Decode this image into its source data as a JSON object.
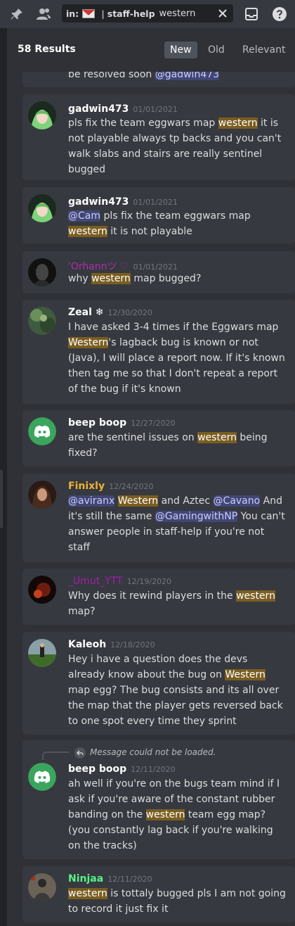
{
  "toolbar": {
    "search_prefix": "in:",
    "channel": "staff-help",
    "separator": "|",
    "query": "western"
  },
  "results": {
    "count": "58 Results",
    "sort_tabs": [
      "New",
      "Old",
      "Relevant"
    ]
  },
  "colors": {
    "highlight": "#7a5d21",
    "mention": "#414675",
    "discord_blurple": "#5865f2",
    "green_bot": "#3ba55d"
  },
  "messages": [
    {
      "text_parts": [
        {
          "t": "be resolved soon "
        },
        {
          "t": "@gadwin473",
          "mention": true
        }
      ]
    },
    {
      "author": "gadwin473",
      "author_color": "#ffffff",
      "timestamp": "01/01/2021",
      "avatar": "anime-avatar",
      "text_parts": [
        {
          "t": "pls fix the team eggwars map "
        },
        {
          "t": "western",
          "hl": true
        },
        {
          "t": " it is not playable always tp backs and you can't walk slabs and stairs are really sentinel bugged"
        }
      ]
    },
    {
      "author": "gadwin473",
      "author_color": "#ffffff",
      "timestamp": "01/01/2021",
      "avatar": "anime-avatar",
      "text_parts": [
        {
          "t": "@Cam",
          "mention": true
        },
        {
          "t": " pls fix the team eggwars map "
        },
        {
          "t": "western",
          "hl": true
        },
        {
          "t": " it is not playable"
        }
      ]
    },
    {
      "author": "'Orhannツ ♡",
      "author_color": "#b02bb1",
      "timestamp": "01/01/2021",
      "avatar": "dark-avatar",
      "text_parts": [
        {
          "t": "why "
        },
        {
          "t": "western",
          "hl": true
        },
        {
          "t": " map bugged?"
        }
      ]
    },
    {
      "author": "Zeal ❄",
      "author_color": "#ffffff",
      "timestamp": "12/30/2020",
      "avatar": "nature-avatar",
      "text_parts": [
        {
          "t": "I have asked 3-4 times if the Eggwars map "
        },
        {
          "t": "Western",
          "hl": true
        },
        {
          "t": "'s lagback bug is known or not (Java), I will place a report now. If it's known then tag me so that I don't repeat a report of the bug if it's known"
        }
      ]
    },
    {
      "author": "beep boop",
      "author_color": "#ffffff",
      "timestamp": "12/27/2020",
      "avatar": "discord-avatar",
      "text_parts": [
        {
          "t": "are the sentinel issues on "
        },
        {
          "t": "western",
          "hl": true
        },
        {
          "t": " being fixed?"
        }
      ]
    },
    {
      "author": "Finixly",
      "author_color": "#f0b232",
      "timestamp": "12/24/2020",
      "avatar": "girl-avatar",
      "text_parts": [
        {
          "t": "@aviranx",
          "mention": true
        },
        {
          "t": " "
        },
        {
          "t": "Western",
          "hl": true
        },
        {
          "t": " and Aztec "
        },
        {
          "t": "@Cavano",
          "mention": true
        },
        {
          "t": " And it's still the same "
        },
        {
          "t": "@GamingwithNP",
          "mention": true
        },
        {
          "t": " You can't answer people in staff-help if you're not staff"
        }
      ]
    },
    {
      "author": "_Umut_YTT",
      "author_color": "#a21caf",
      "timestamp": "12/19/2020",
      "avatar": "red-avatar",
      "text_parts": [
        {
          "t": "Why does it rewind players in the "
        },
        {
          "t": "western",
          "hl": true
        },
        {
          "t": " map?"
        }
      ]
    },
    {
      "author": "Kaleoh",
      "author_color": "#ffffff",
      "timestamp": "12/18/2020",
      "avatar": "field-avatar",
      "text_parts": [
        {
          "t": "Hey i have a question does the devs already know about the bug on "
        },
        {
          "t": "Western",
          "hl": true
        },
        {
          "t": " map egg? The bug consists and its all over the map that the player gets reversed back to one spot every time they sprint"
        }
      ]
    },
    {
      "author": "beep boop",
      "author_color": "#ffffff",
      "timestamp": "12/11/2020",
      "avatar": "discord-avatar",
      "reply_note": "Message could not be loaded.",
      "text_parts": [
        {
          "t": "ah well if you're on the bugs team mind if I ask if you're aware of the constant rubber banding on the "
        },
        {
          "t": "western",
          "hl": true
        },
        {
          "t": " team egg map? (you constantly lag back if you're walking on the tracks)"
        }
      ]
    },
    {
      "author": "Ninjaa",
      "author_color": "#57f287",
      "timestamp": "12/11/2020",
      "avatar": "ninja-avatar",
      "text_parts": [
        {
          "t": "western",
          "hl": true
        },
        {
          "t": " is tottaly bugged pls I am not going to record it just fix it"
        }
      ]
    }
  ]
}
